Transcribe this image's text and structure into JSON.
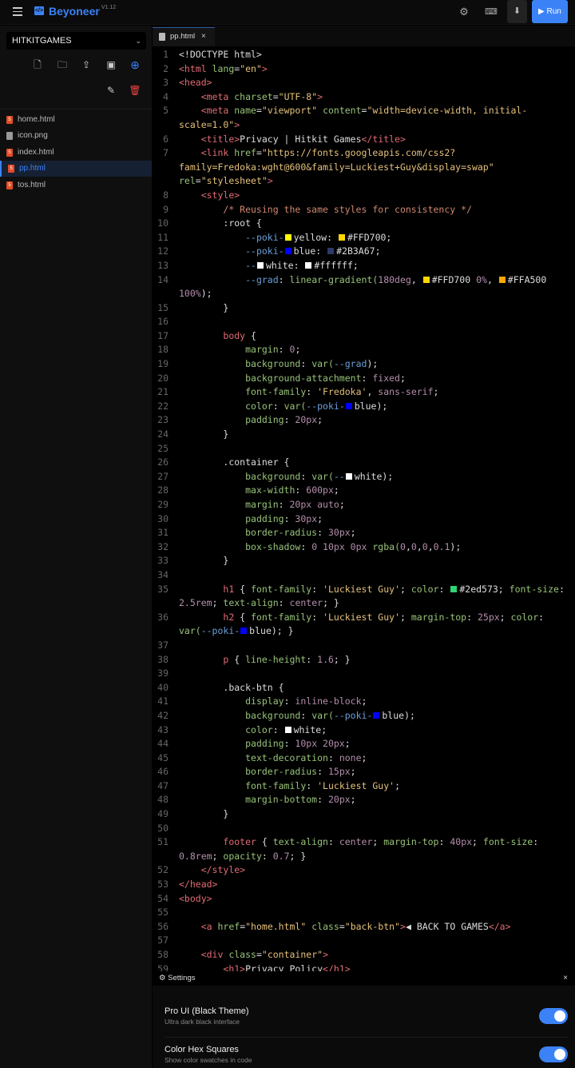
{
  "header": {
    "brand": "Beyoneer",
    "version": "V1.12",
    "run_label": "Run"
  },
  "sidebar": {
    "project": "HITKITGAMES",
    "files": [
      {
        "name": "home.html",
        "type": "html"
      },
      {
        "name": "icon.png",
        "type": "image"
      },
      {
        "name": "index.html",
        "type": "html"
      },
      {
        "name": "pp.html",
        "type": "html",
        "active": true
      },
      {
        "name": "tos.html",
        "type": "html"
      }
    ]
  },
  "tab": {
    "label": "pp.html",
    "close": "×"
  },
  "editor": {
    "lines": [
      [
        [
          "p",
          "<!DOCTYPE html>"
        ]
      ],
      [
        [
          "t",
          "<html"
        ],
        [
          "a",
          " lang"
        ],
        [
          "p",
          "="
        ],
        [
          "s",
          "\"en\""
        ],
        [
          "t",
          ">"
        ]
      ],
      [
        [
          "t",
          "<head>"
        ]
      ],
      [
        [
          "p",
          "    "
        ],
        [
          "t",
          "<meta"
        ],
        [
          "a",
          " charset"
        ],
        [
          "p",
          "="
        ],
        [
          "s",
          "\"UTF-8\""
        ],
        [
          "t",
          ">"
        ]
      ],
      [
        [
          "p",
          "    "
        ],
        [
          "t",
          "<meta"
        ],
        [
          "a",
          " name"
        ],
        [
          "p",
          "="
        ],
        [
          "s",
          "\"viewport\""
        ],
        [
          "a",
          " content"
        ],
        [
          "p",
          "="
        ],
        [
          "s",
          "\"width=device-width, initial-scale=1.0\""
        ],
        [
          "t",
          ">"
        ]
      ],
      [
        [
          "p",
          "    "
        ],
        [
          "t",
          "<title>"
        ],
        [
          "p",
          "Privacy | Hitkit Games"
        ],
        [
          "t",
          "</title>"
        ]
      ],
      [
        [
          "p",
          "    "
        ],
        [
          "t",
          "<link"
        ],
        [
          "a",
          " href"
        ],
        [
          "p",
          "="
        ],
        [
          "s",
          "\"https://fonts.googleapis.com/css2? family=Fredoka:wght@600&family=Luckiest+Guy&display=swap\""
        ],
        [
          "a",
          " rel"
        ],
        [
          "p",
          "="
        ],
        [
          "s",
          "\"stylesheet\""
        ],
        [
          "t",
          ">"
        ]
      ],
      [
        [
          "p",
          "    "
        ],
        [
          "t",
          "<style>"
        ]
      ],
      [
        [
          "p",
          "        "
        ],
        [
          "c",
          "/* Reusing the same styles for consistency */"
        ]
      ],
      [
        [
          "p",
          "        :root {"
        ]
      ],
      [
        [
          "p",
          "            "
        ],
        [
          "v",
          "--poki-"
        ],
        [
          "sw",
          "#FFFF00"
        ],
        [
          "p",
          "yellow: "
        ],
        [
          "sw",
          "#FFD700"
        ],
        [
          "p",
          "#FFD700;"
        ]
      ],
      [
        [
          "p",
          "            "
        ],
        [
          "v",
          "--poki-"
        ],
        [
          "sw",
          "#0000FF"
        ],
        [
          "p",
          "blue: "
        ],
        [
          "sw",
          "#2B3A67"
        ],
        [
          "p",
          "#2B3A67;"
        ]
      ],
      [
        [
          "p",
          "            "
        ],
        [
          "v",
          "--"
        ],
        [
          "sw",
          "#FFFFFF"
        ],
        [
          "p",
          "white: "
        ],
        [
          "sw",
          "#ffffff"
        ],
        [
          "p",
          "#ffffff;"
        ]
      ],
      [
        [
          "p",
          "            "
        ],
        [
          "v",
          "--grad"
        ],
        [
          "p",
          ": "
        ],
        [
          "k",
          "linear-gradient("
        ],
        [
          "n",
          "180deg"
        ],
        [
          "p",
          ", "
        ],
        [
          "sw",
          "#FFD700"
        ],
        [
          "p",
          "#FFD700 "
        ],
        [
          "n",
          "0%"
        ],
        [
          "p",
          ", "
        ],
        [
          "sw",
          "#FFA500"
        ],
        [
          "p",
          "#FFA500 "
        ],
        [
          "n",
          "100%"
        ],
        [
          "p",
          ");"
        ]
      ],
      [
        [
          "p",
          "        }"
        ]
      ],
      [],
      [
        [
          "p",
          "        "
        ],
        [
          "t",
          "body"
        ],
        [
          "p",
          " {"
        ]
      ],
      [
        [
          "p",
          "            "
        ],
        [
          "k",
          "margin"
        ],
        [
          "p",
          ": "
        ],
        [
          "n",
          "0"
        ],
        [
          "p",
          ";"
        ]
      ],
      [
        [
          "p",
          "            "
        ],
        [
          "k",
          "background"
        ],
        [
          "p",
          ": "
        ],
        [
          "k",
          "var("
        ],
        [
          "v",
          "--grad"
        ],
        [
          "p",
          ");"
        ]
      ],
      [
        [
          "p",
          "            "
        ],
        [
          "k",
          "background-attachment"
        ],
        [
          "p",
          ": "
        ],
        [
          "n",
          "fixed"
        ],
        [
          "p",
          ";"
        ]
      ],
      [
        [
          "p",
          "            "
        ],
        [
          "k",
          "font-family"
        ],
        [
          "p",
          ": "
        ],
        [
          "s",
          "'Fredoka'"
        ],
        [
          "p",
          ", "
        ],
        [
          "n",
          "sans-serif"
        ],
        [
          "p",
          ";"
        ]
      ],
      [
        [
          "p",
          "            "
        ],
        [
          "k",
          "color"
        ],
        [
          "p",
          ": "
        ],
        [
          "k",
          "var("
        ],
        [
          "v",
          "--poki-"
        ],
        [
          "sw",
          "#0000FF"
        ],
        [
          "p",
          "blue);"
        ]
      ],
      [
        [
          "p",
          "            "
        ],
        [
          "k",
          "padding"
        ],
        [
          "p",
          ": "
        ],
        [
          "n",
          "20px"
        ],
        [
          "p",
          ";"
        ]
      ],
      [
        [
          "p",
          "        }"
        ]
      ],
      [],
      [
        [
          "p",
          "        .container {"
        ]
      ],
      [
        [
          "p",
          "            "
        ],
        [
          "k",
          "background"
        ],
        [
          "p",
          ": "
        ],
        [
          "k",
          "var("
        ],
        [
          "v",
          "--"
        ],
        [
          "sw",
          "#FFFFFF"
        ],
        [
          "p",
          "white);"
        ]
      ],
      [
        [
          "p",
          "            "
        ],
        [
          "k",
          "max-width"
        ],
        [
          "p",
          ": "
        ],
        [
          "n",
          "600px"
        ],
        [
          "p",
          ";"
        ]
      ],
      [
        [
          "p",
          "            "
        ],
        [
          "k",
          "margin"
        ],
        [
          "p",
          ": "
        ],
        [
          "n",
          "20px auto"
        ],
        [
          "p",
          ";"
        ]
      ],
      [
        [
          "p",
          "            "
        ],
        [
          "k",
          "padding"
        ],
        [
          "p",
          ": "
        ],
        [
          "n",
          "30px"
        ],
        [
          "p",
          ";"
        ]
      ],
      [
        [
          "p",
          "            "
        ],
        [
          "k",
          "border-radius"
        ],
        [
          "p",
          ": "
        ],
        [
          "n",
          "30px"
        ],
        [
          "p",
          ";"
        ]
      ],
      [
        [
          "p",
          "            "
        ],
        [
          "k",
          "box-shadow"
        ],
        [
          "p",
          ": "
        ],
        [
          "n",
          "0 10px 0px "
        ],
        [
          "k",
          "rgba("
        ],
        [
          "n",
          "0"
        ],
        [
          "p",
          ","
        ],
        [
          "n",
          "0"
        ],
        [
          "p",
          ","
        ],
        [
          "n",
          "0"
        ],
        [
          "p",
          ","
        ],
        [
          "n",
          "0.1"
        ],
        [
          "p",
          ");"
        ]
      ],
      [
        [
          "p",
          "        }"
        ]
      ],
      [],
      [
        [
          "p",
          "        "
        ],
        [
          "t",
          "h1"
        ],
        [
          "p",
          " { "
        ],
        [
          "k",
          "font-family"
        ],
        [
          "p",
          ": "
        ],
        [
          "s",
          "'Luckiest Guy'"
        ],
        [
          "p",
          "; "
        ],
        [
          "k",
          "color"
        ],
        [
          "p",
          ": "
        ],
        [
          "sw",
          "#2ed573"
        ],
        [
          "p",
          "#2ed573; "
        ],
        [
          "k",
          "font-size"
        ],
        [
          "p",
          ": "
        ],
        [
          "n",
          "2.5rem"
        ],
        [
          "p",
          "; "
        ],
        [
          "k",
          "text-align"
        ],
        [
          "p",
          ": "
        ],
        [
          "n",
          "center"
        ],
        [
          "p",
          "; }"
        ]
      ],
      [
        [
          "p",
          "        "
        ],
        [
          "t",
          "h2"
        ],
        [
          "p",
          " { "
        ],
        [
          "k",
          "font-family"
        ],
        [
          "p",
          ": "
        ],
        [
          "s",
          "'Luckiest Guy'"
        ],
        [
          "p",
          "; "
        ],
        [
          "k",
          "margin-top"
        ],
        [
          "p",
          ": "
        ],
        [
          "n",
          "25px"
        ],
        [
          "p",
          "; "
        ],
        [
          "k",
          "color"
        ],
        [
          "p",
          ": "
        ],
        [
          "k",
          "var("
        ],
        [
          "v",
          "--poki-"
        ],
        [
          "sw",
          "#0000FF"
        ],
        [
          "p",
          "blue); }"
        ]
      ],
      [],
      [
        [
          "p",
          "        "
        ],
        [
          "t",
          "p"
        ],
        [
          "p",
          " { "
        ],
        [
          "k",
          "line-height"
        ],
        [
          "p",
          ": "
        ],
        [
          "n",
          "1.6"
        ],
        [
          "p",
          "; }"
        ]
      ],
      [],
      [
        [
          "p",
          "        .back-btn {"
        ]
      ],
      [
        [
          "p",
          "            "
        ],
        [
          "k",
          "display"
        ],
        [
          "p",
          ": "
        ],
        [
          "n",
          "inline-block"
        ],
        [
          "p",
          ";"
        ]
      ],
      [
        [
          "p",
          "            "
        ],
        [
          "k",
          "background"
        ],
        [
          "p",
          ": "
        ],
        [
          "k",
          "var("
        ],
        [
          "v",
          "--poki-"
        ],
        [
          "sw",
          "#0000FF"
        ],
        [
          "p",
          "blue);"
        ]
      ],
      [
        [
          "p",
          "            "
        ],
        [
          "k",
          "color"
        ],
        [
          "p",
          ": "
        ],
        [
          "sw",
          "#FFFFFF"
        ],
        [
          "p",
          "white;"
        ]
      ],
      [
        [
          "p",
          "            "
        ],
        [
          "k",
          "padding"
        ],
        [
          "p",
          ": "
        ],
        [
          "n",
          "10px 20px"
        ],
        [
          "p",
          ";"
        ]
      ],
      [
        [
          "p",
          "            "
        ],
        [
          "k",
          "text-decoration"
        ],
        [
          "p",
          ": "
        ],
        [
          "n",
          "none"
        ],
        [
          "p",
          ";"
        ]
      ],
      [
        [
          "p",
          "            "
        ],
        [
          "k",
          "border-radius"
        ],
        [
          "p",
          ": "
        ],
        [
          "n",
          "15px"
        ],
        [
          "p",
          ";"
        ]
      ],
      [
        [
          "p",
          "            "
        ],
        [
          "k",
          "font-family"
        ],
        [
          "p",
          ": "
        ],
        [
          "s",
          "'Luckiest Guy'"
        ],
        [
          "p",
          ";"
        ]
      ],
      [
        [
          "p",
          "            "
        ],
        [
          "k",
          "margin-bottom"
        ],
        [
          "p",
          ": "
        ],
        [
          "n",
          "20px"
        ],
        [
          "p",
          ";"
        ]
      ],
      [
        [
          "p",
          "        }"
        ]
      ],
      [],
      [
        [
          "p",
          "        "
        ],
        [
          "t",
          "footer"
        ],
        [
          "p",
          " { "
        ],
        [
          "k",
          "text-align"
        ],
        [
          "p",
          ": "
        ],
        [
          "n",
          "center"
        ],
        [
          "p",
          "; "
        ],
        [
          "k",
          "margin-top"
        ],
        [
          "p",
          ": "
        ],
        [
          "n",
          "40px"
        ],
        [
          "p",
          "; "
        ],
        [
          "k",
          "font-size"
        ],
        [
          "p",
          ": "
        ],
        [
          "n",
          "0.8rem"
        ],
        [
          "p",
          "; "
        ],
        [
          "k",
          "opacity"
        ],
        [
          "p",
          ": "
        ],
        [
          "n",
          "0.7"
        ],
        [
          "p",
          "; }"
        ]
      ],
      [
        [
          "p",
          "    "
        ],
        [
          "t",
          "</style>"
        ]
      ],
      [
        [
          "t",
          "</head>"
        ]
      ],
      [
        [
          "t",
          "<body>"
        ]
      ],
      [],
      [
        [
          "p",
          "    "
        ],
        [
          "t",
          "<a"
        ],
        [
          "a",
          " href"
        ],
        [
          "p",
          "="
        ],
        [
          "s",
          "\"home.html\""
        ],
        [
          "a",
          " class"
        ],
        [
          "p",
          "="
        ],
        [
          "s",
          "\"back-btn\""
        ],
        [
          "t",
          ">"
        ],
        [
          "p",
          "◀ BACK TO GAMES"
        ],
        [
          "t",
          "</a>"
        ]
      ],
      [],
      [
        [
          "p",
          "    "
        ],
        [
          "t",
          "<div"
        ],
        [
          "a",
          " class"
        ],
        [
          "p",
          "="
        ],
        [
          "s",
          "\"container\""
        ],
        [
          "t",
          ">"
        ]
      ],
      [
        [
          "p",
          "        "
        ],
        [
          "t",
          "<h1>"
        ],
        [
          "p",
          "Privacy Policy"
        ],
        [
          "t",
          "</h1>"
        ]
      ]
    ]
  },
  "settings": {
    "title": "Settings",
    "close": "×",
    "options": [
      {
        "label": "Pro UI (Black Theme)",
        "desc": "Ultra dark black interface",
        "enabled": true
      },
      {
        "label": "Color Hex Squares",
        "desc": "Show color swatches in code",
        "enabled": true
      }
    ]
  }
}
